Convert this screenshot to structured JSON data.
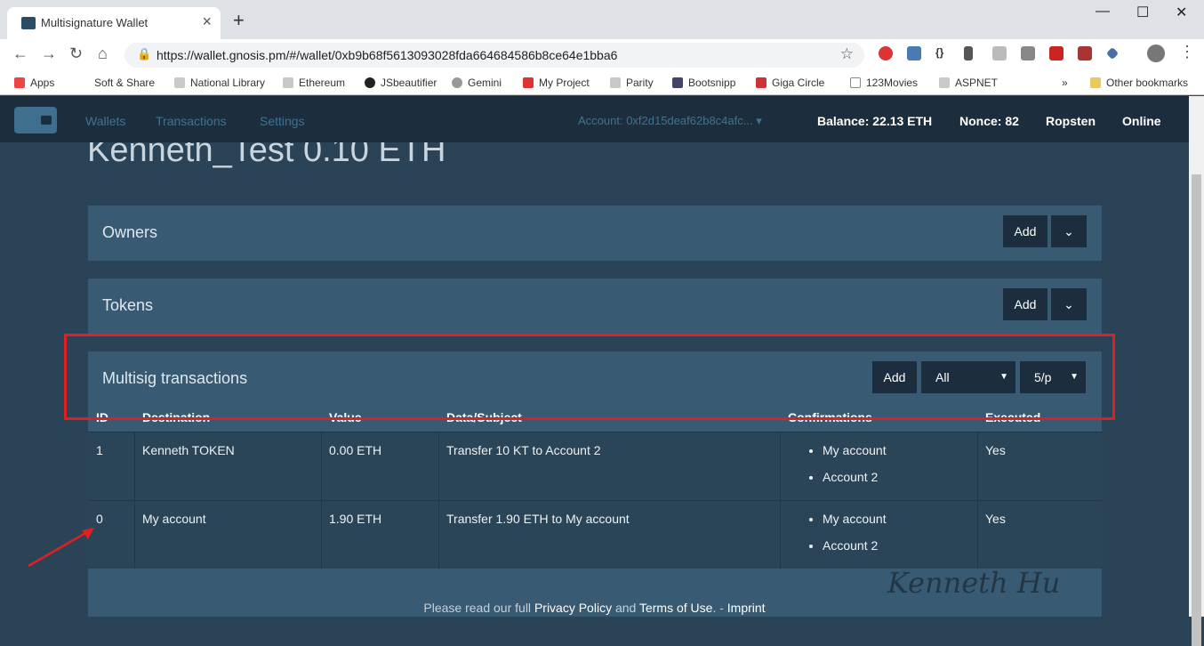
{
  "browser": {
    "tab_title": "Multisignature Wallet",
    "url": "https://wallet.gnosis.pm/#/wallet/0xb9b68f5613093028fda664684586b8ce64e1bba6",
    "bookmarks": [
      "Apps",
      "Soft & Share",
      "National Library",
      "Ethereum",
      "JSbeautifier",
      "Gemini",
      "My Project",
      "Parity",
      "Bootsnipp",
      "Giga Circle",
      "123Movies",
      "ASPNET"
    ],
    "more": "»",
    "other_bookmarks": "Other bookmarks"
  },
  "navbar": {
    "links": [
      "Wallets",
      "Transactions",
      "Settings"
    ],
    "account": "Account: 0xf2d15deaf62b8c4afc...",
    "balance": "Balance: 22.13 ETH",
    "nonce": "Nonce: 82",
    "network": "Ropsten",
    "status": "Online"
  },
  "wallet": {
    "title": "Kenneth_Test 0.10 ETH"
  },
  "owners": {
    "title": "Owners",
    "add": "Add"
  },
  "tokens": {
    "title": "Tokens",
    "add": "Add"
  },
  "multisig": {
    "title": "Multisig transactions",
    "add": "Add",
    "filter": "All",
    "per_page": "5/p",
    "columns": [
      "ID",
      "Destination",
      "Value",
      "Data/Subject",
      "Confirmations",
      "Executed"
    ],
    "rows": [
      {
        "id": "1",
        "destination": "Kenneth TOKEN",
        "value": "0.00 ETH",
        "subject": "Transfer 10 KT to Account 2",
        "confirmations": [
          "My account",
          "Account 2"
        ],
        "executed": "Yes"
      },
      {
        "id": "0",
        "destination": "My account",
        "value": "1.90 ETH",
        "subject": "Transfer 1.90 ETH to My account",
        "confirmations": [
          "My account",
          "Account 2"
        ],
        "executed": "Yes"
      }
    ]
  },
  "footer": {
    "prefix": "Please read our full",
    "privacy": "Privacy Policy",
    "and": "and",
    "terms": "Terms of Use",
    "sep": ". -",
    "imprint": "Imprint"
  },
  "signature": "Kenneth Hu",
  "colors": {
    "highlight": "#e02020",
    "navbar": "#1c2e3d",
    "panel": "#385a72"
  }
}
